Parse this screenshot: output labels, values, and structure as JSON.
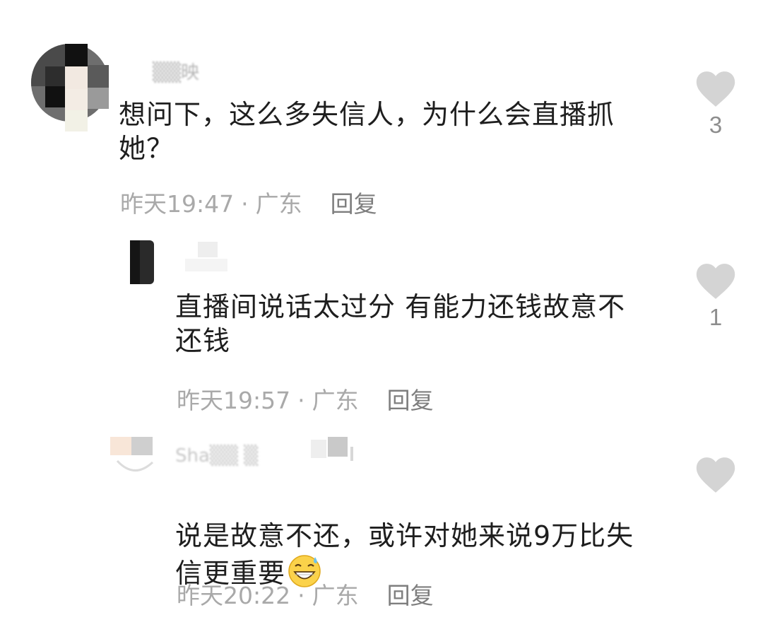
{
  "comments": [
    {
      "username": "▒▒映",
      "text": "想问下，这么多失信人，为什么会直播抓\n她？",
      "time": "昨天19:47",
      "location": "广东",
      "reply_label": "回复",
      "likes": "3"
    },
    {
      "username": "▒▒",
      "text": "直播间说话太过分  有能力还钱故意不\n还钱",
      "time": "昨天19:57",
      "location": "广东",
      "reply_label": "回复",
      "likes": "1"
    },
    {
      "username": "Sha▒▒    ▒",
      "text": "说是故意不还，或许对她来说9万比失\n信更重要",
      "emoji": "grinning-sweat-emoji",
      "time": "昨天20:22",
      "location": "广东",
      "reply_label": "回复",
      "likes": ""
    }
  ],
  "separator": "·",
  "colors": {
    "heart": "#d4d4d4",
    "meta_text": "#a9a9a9",
    "body_text": "#1e1e1e"
  },
  "icons": {
    "like": "heart-icon",
    "avatar": "pixelated-avatar"
  }
}
